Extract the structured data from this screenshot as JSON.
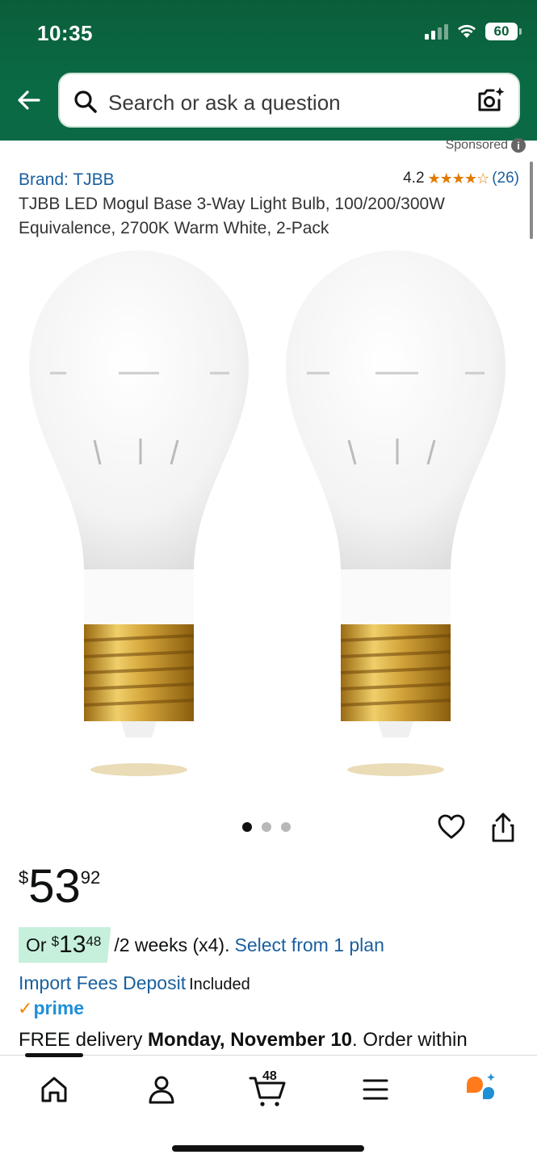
{
  "status_bar": {
    "time": "10:35",
    "battery": "60"
  },
  "header": {
    "search_placeholder": "Search or ask a question"
  },
  "sponsored_label": "Sponsored",
  "product": {
    "brand": "Brand: TJBB",
    "rating": "4.2",
    "rating_count": "(26)",
    "title": "TJBB LED Mogul Base 3-Way Light Bulb, 100/200/300W Equivalence, 2700K Warm White, 2-Pack",
    "image_count": 3,
    "active_image_index": 0
  },
  "price": {
    "currency": "$",
    "whole": "53",
    "fraction": "92"
  },
  "installment": {
    "prefix": "Or",
    "currency": "$",
    "whole": "13",
    "fraction": "48",
    "terms": "/2 weeks (x4).",
    "link": "Select from 1 plan"
  },
  "import_fees": {
    "link": "Import Fees Deposit",
    "status": "Included"
  },
  "prime_label": "prime",
  "delivery": {
    "prefix": "FREE delivery",
    "date": "Monday, November 10",
    "suffix": ". Order within"
  },
  "bottom_nav": {
    "items": [
      "home-icon",
      "account-icon",
      "cart-icon",
      "menu-icon",
      "rufus-icon"
    ],
    "cart_count": "48"
  },
  "colors": {
    "header_green": "#0b5e3a",
    "link_blue": "#1a5f9e",
    "star_orange": "#e07b00",
    "installment_bg": "#c7f0dc",
    "prime_blue": "#1f8fd6"
  }
}
